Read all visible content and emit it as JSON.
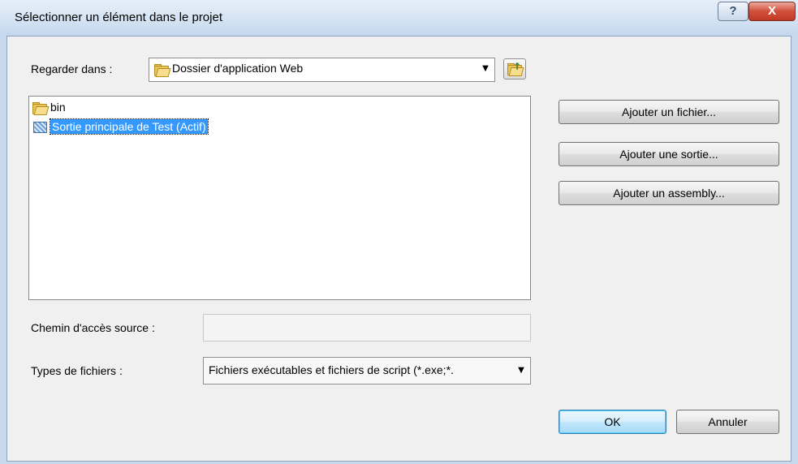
{
  "window": {
    "title": "Sélectionner un élément dans le projet",
    "help_label": "?",
    "close_label": "X"
  },
  "look_in": {
    "label": "Regarder dans :",
    "value": "Dossier d'application Web",
    "folder_icon": "folder-icon",
    "up_icon": "folder-up-icon"
  },
  "list": {
    "items": [
      {
        "label": "bin",
        "icon": "folder-icon",
        "selected": false
      },
      {
        "label": "Sortie principale de Test (Actif)",
        "icon": "project-output-icon",
        "selected": true
      }
    ]
  },
  "source_path": {
    "label": "Chemin d'accès source :",
    "value": ""
  },
  "file_types": {
    "label": "Types de fichiers :",
    "value": "Fichiers exécutables et fichiers de script (*.exe;*."
  },
  "buttons": {
    "add_file": "Ajouter un fichier...",
    "add_output": "Ajouter une sortie...",
    "add_assembly": "Ajouter un assembly...",
    "ok": "OK",
    "cancel": "Annuler"
  }
}
